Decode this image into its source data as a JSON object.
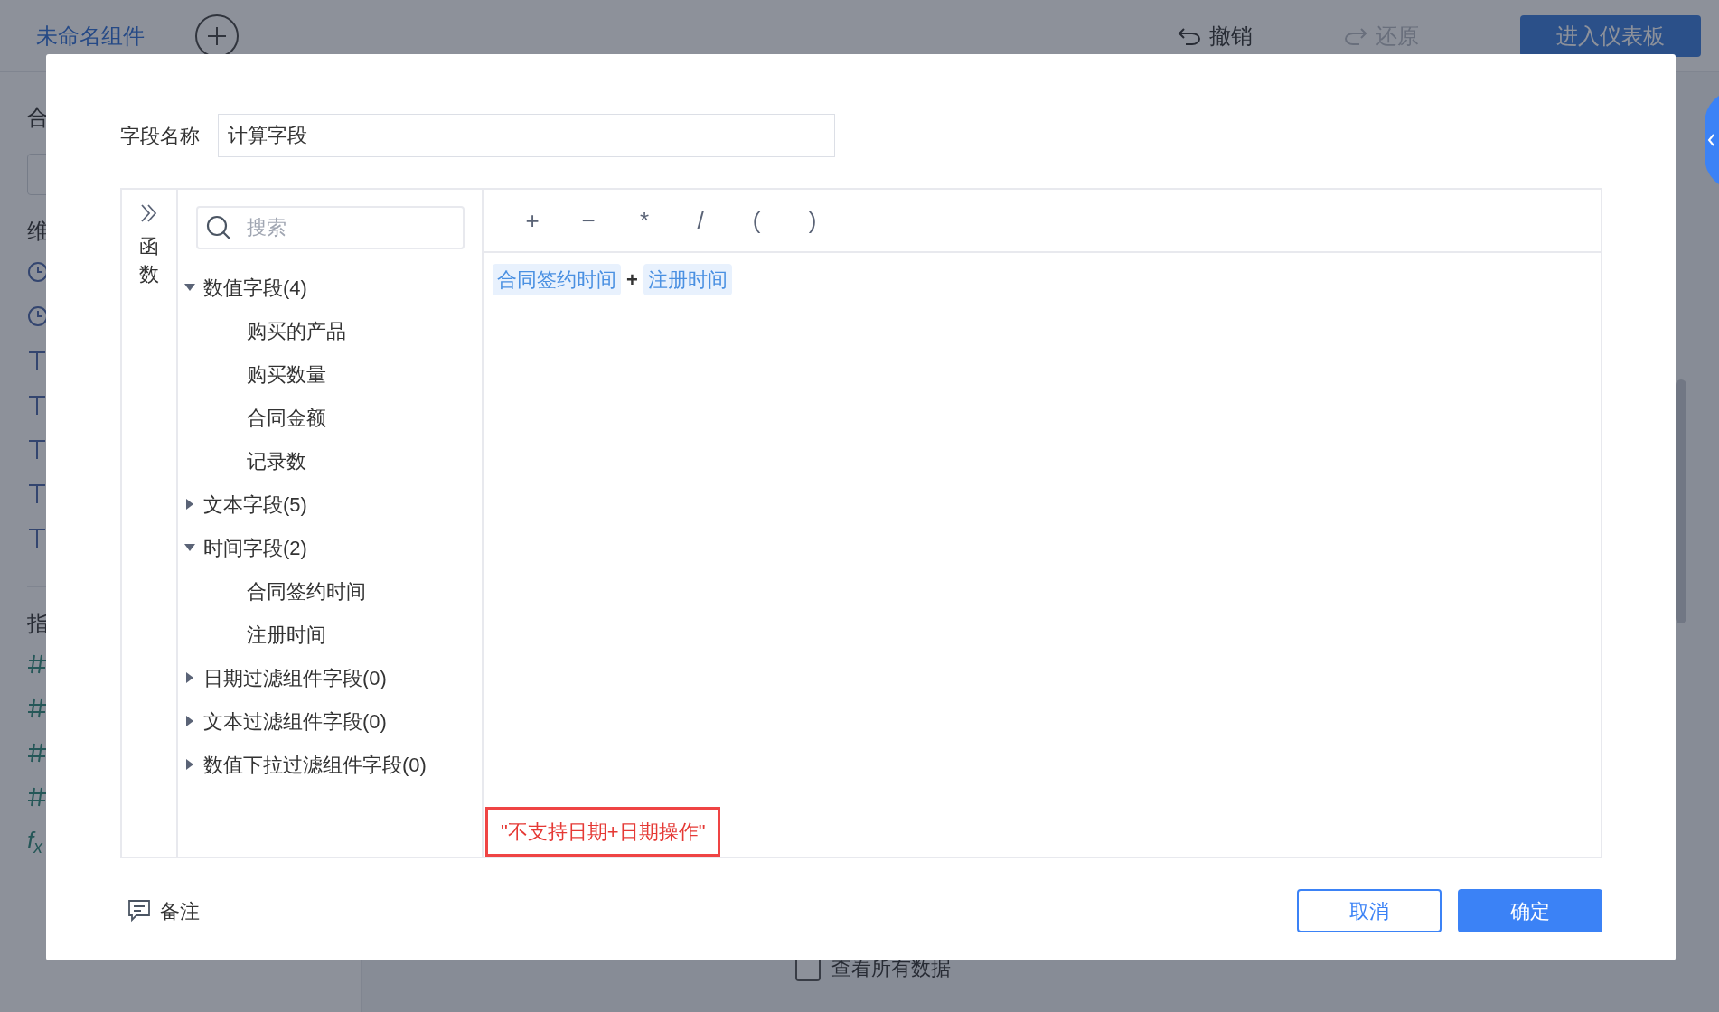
{
  "app": {
    "component_tab": "未命名组件",
    "undo": {
      "label": "撤销",
      "disabled": false
    },
    "redo": {
      "label": "还原",
      "disabled": true
    },
    "enter_dashboard": "进入仪表板",
    "sidebar": [
      {
        "heading": "合"
      },
      {
        "heading": "维",
        "items": [
          {
            "kind": "time"
          },
          {
            "kind": "time"
          },
          {
            "kind": "text"
          },
          {
            "kind": "text"
          },
          {
            "kind": "text"
          },
          {
            "kind": "text"
          },
          {
            "kind": "text"
          }
        ]
      },
      {
        "heading": "指",
        "items": [
          {
            "kind": "number"
          },
          {
            "kind": "number"
          },
          {
            "kind": "number"
          },
          {
            "kind": "number"
          },
          {
            "kind": "formula",
            "glyph": "f$_{x}$"
          }
        ]
      }
    ],
    "view_all_data": {
      "label": "查看所有数据",
      "checked": false
    }
  },
  "dialog": {
    "field_name_label": "字段名称",
    "field_name_value": "计算字段",
    "functions_label": "函数",
    "search": {
      "placeholder": "搜索"
    },
    "tree": [
      {
        "label": "数值字段(4)",
        "expanded": true,
        "children": [
          {
            "label": "购买的产品"
          },
          {
            "label": "购买数量"
          },
          {
            "label": "合同金额"
          },
          {
            "label": "记录数"
          }
        ]
      },
      {
        "label": "文本字段(5)",
        "expanded": false
      },
      {
        "label": "时间字段(2)",
        "expanded": true,
        "children": [
          {
            "label": "合同签约时间"
          },
          {
            "label": "注册时间"
          }
        ]
      },
      {
        "label": "日期过滤组件字段(0)",
        "expanded": false
      },
      {
        "label": "文本过滤组件字段(0)",
        "expanded": false
      },
      {
        "label": "数值下拉过滤组件字段(0)",
        "expanded": false
      }
    ],
    "operators": [
      "+",
      "−",
      "*",
      "/",
      "(",
      ")"
    ],
    "formula": [
      {
        "kind": "field",
        "text": "合同签约时间"
      },
      {
        "kind": "operator",
        "text": "+"
      },
      {
        "kind": "field",
        "text": "注册时间"
      }
    ],
    "error": "\"不支持日期+日期操作\"",
    "note": "备注",
    "cancel": "取消",
    "confirm": "确定"
  }
}
